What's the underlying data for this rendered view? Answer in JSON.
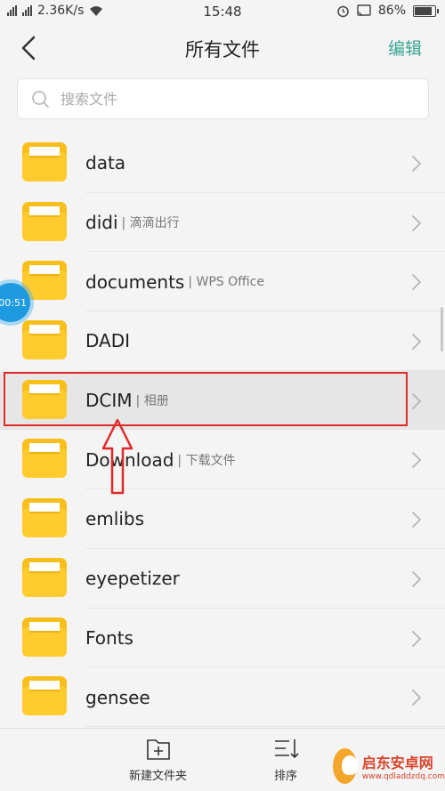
{
  "status": {
    "net_speed": "2.36K/s",
    "time": "15:48",
    "battery": "86%",
    "battery_level": 0.86
  },
  "nav": {
    "title": "所有文件",
    "edit_label": "编辑"
  },
  "search": {
    "placeholder": "搜索文件"
  },
  "files": [
    {
      "name": "data",
      "sub": ""
    },
    {
      "name": "didi",
      "sub": "| 滴滴出行"
    },
    {
      "name": "documents",
      "sub": "| WPS Office"
    },
    {
      "name": "DADI",
      "sub": ""
    },
    {
      "name": "DCIM",
      "sub": "| 相册"
    },
    {
      "name": "Download",
      "sub": "| 下载文件"
    },
    {
      "name": "emlibs",
      "sub": ""
    },
    {
      "name": "eyepetizer",
      "sub": ""
    },
    {
      "name": "Fonts",
      "sub": ""
    },
    {
      "name": "gensee",
      "sub": ""
    }
  ],
  "bottom": {
    "new_folder_label": "新建文件夹",
    "sort_label": "排序"
  },
  "overlay": {
    "timer": "00:51"
  },
  "watermark": {
    "title": "启东安卓网",
    "url": "www.qdladdzdq.com"
  },
  "colors": {
    "accent": "#3aa693",
    "folder": "#f8be1a",
    "highlight": "#e02a2a"
  }
}
